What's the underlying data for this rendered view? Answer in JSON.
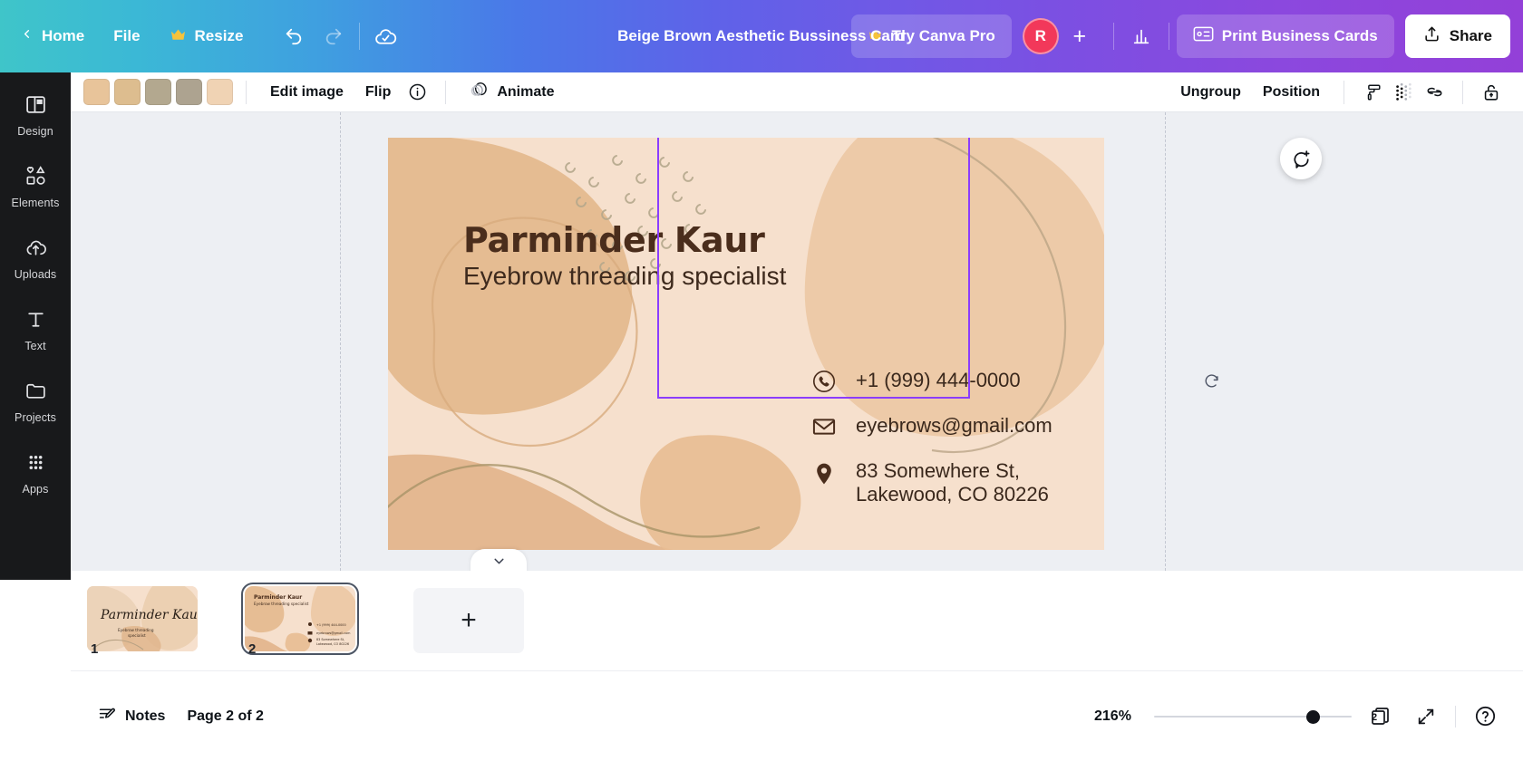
{
  "topbar": {
    "home_label": "Home",
    "file_label": "File",
    "resize_label": "Resize",
    "resize_icon": "crown-icon",
    "back_icon": "chevron-left-icon",
    "undo_icon": "undo-icon",
    "redo_icon": "redo-icon",
    "cloud_icon": "cloud-saved-icon",
    "doc_title": "Beige Brown Aesthetic Bussiness Card",
    "try_pro_label": "Try Canva Pro",
    "try_pro_icon": "crown-icon",
    "avatar_initial": "R",
    "add_member_icon": "plus-icon",
    "insights_icon": "bar-chart-icon",
    "print_label": "Print Business Cards",
    "print_icon": "business-card-icon",
    "share_label": "Share",
    "share_icon": "upload-icon",
    "accent_avatar": "#f2385a",
    "gradient_start": "#3fc5c9",
    "gradient_end": "#9340d8"
  },
  "toolbar": {
    "swatches": [
      "#e8c49a",
      "#ddbd8f",
      "#b3a88f",
      "#ada390",
      "#f0d3b4"
    ],
    "edit_image_label": "Edit image",
    "flip_label": "Flip",
    "info_icon": "info-circle-icon",
    "animate_label": "Animate",
    "animate_icon": "animate-icon",
    "ungroup_label": "Ungroup",
    "position_label": "Position",
    "paint_roller_icon": "paint-roller-icon",
    "transparency_icon": "transparency-dots-icon",
    "link_icon": "link-icon",
    "lock_icon": "lock-open-icon"
  },
  "sidebar": {
    "items": [
      {
        "label": "Design",
        "icon": "design-panel-icon"
      },
      {
        "label": "Elements",
        "icon": "shapes-icon"
      },
      {
        "label": "Uploads",
        "icon": "cloud-upload-icon"
      },
      {
        "label": "Text",
        "icon": "text-t-icon"
      },
      {
        "label": "Projects",
        "icon": "folder-icon"
      },
      {
        "label": "Apps",
        "icon": "grid-dots-icon"
      }
    ]
  },
  "card": {
    "name": "Parminder Kaur",
    "subtitle": "Eyebrow threading specialist",
    "background": "#f6e0cd",
    "text_color": "#4a2d1c",
    "contact": [
      {
        "icon": "phone-icon",
        "text": "+1 (999) 444-0000"
      },
      {
        "icon": "envelope-icon",
        "text": "eyebrows@gmail.com"
      },
      {
        "icon": "location-pin-icon",
        "text": "83 Somewhere St,\nLakewood, CO 80226"
      }
    ]
  },
  "canvas": {
    "comment_icon": "add-comment-icon",
    "rotate_icon": "rotate-icon",
    "scroll_icon": "chevron-down-icon",
    "selection_color": "#8b3dff"
  },
  "pagestrip": {
    "pages": [
      {
        "number": "1",
        "name": "Parminder Kaur",
        "subtitle": "Eyebrow threading specialist",
        "selected": false
      },
      {
        "number": "2",
        "name": "Parminder Kaur",
        "subtitle": "Eyebrow threading specialist",
        "selected": true
      }
    ],
    "add_page_icon": "plus-icon"
  },
  "statusbar": {
    "notes_label": "Notes",
    "notes_icon": "notes-icon",
    "page_indicator": "Page 2 of 2",
    "zoom_percent": "216%",
    "page_count": "2",
    "page_count_icon": "pages-icon",
    "fullscreen_icon": "expand-icon",
    "help_icon": "help-circle-icon"
  }
}
